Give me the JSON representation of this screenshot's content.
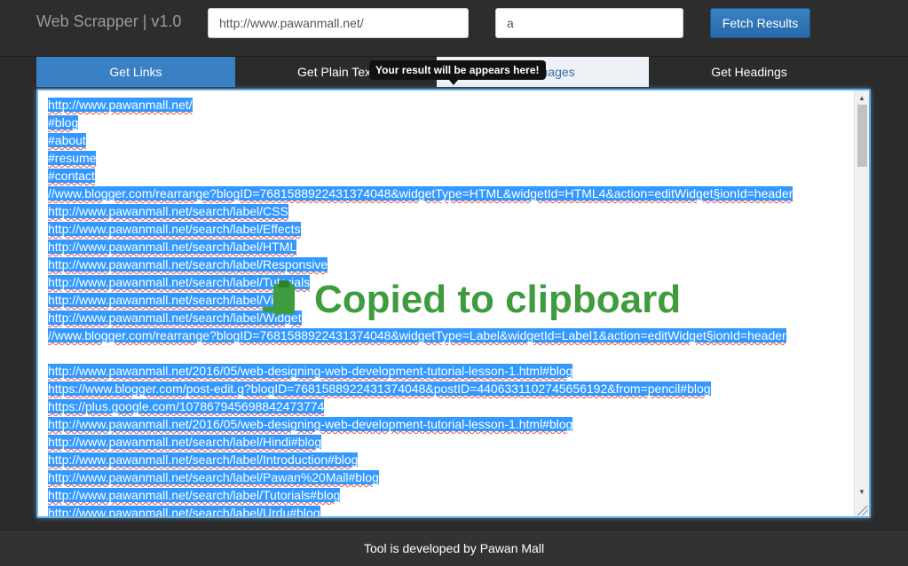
{
  "header": {
    "brand": "Web Scrapper | v1.0",
    "url_value": "http://www.pawanmall.net/",
    "term_value": "a",
    "fetch_label": "Fetch Results"
  },
  "tabs": [
    {
      "label": "Get Links"
    },
    {
      "label": "Get Plain Text"
    },
    {
      "label": "Get Images"
    },
    {
      "label": "Get Headings"
    }
  ],
  "tooltip": "Your result will be appears here!",
  "toast": "Copied to clipboard",
  "result_lines": [
    "http://www.pawanmall.net/",
    "#blog",
    "#about",
    "#resume",
    "#contact",
    "//www.blogger.com/rearrange?blogID=7681588922431374048&widgetType=HTML&widgetId=HTML4&action=editWidget§ionId=header",
    "http://www.pawanmall.net/search/label/CSS",
    "http://www.pawanmall.net/search/label/Effects",
    "http://www.pawanmall.net/search/label/HTML",
    "http://www.pawanmall.net/search/label/Responsive",
    "http://www.pawanmall.net/search/label/Tutorials",
    "http://www.pawanmall.net/search/label/Video",
    "http://www.pawanmall.net/search/label/Widget",
    "//www.blogger.com/rearrange?blogID=7681588922431374048&widgetType=Label&widgetId=Label1&action=editWidget§ionId=header",
    "",
    "http://www.pawanmall.net/2016/05/web-designing-web-development-tutorial-lesson-1.html#blog",
    "https://www.blogger.com/post-edit.g?blogID=7681588922431374048&postID=4406331102745656192&from=pencil#blog",
    "https://plus.google.com/107867945698842473774",
    "http://www.pawanmall.net/2016/05/web-designing-web-development-tutorial-lesson-1.html#blog",
    "http://www.pawanmall.net/search/label/Hindi#blog",
    "http://www.pawanmall.net/search/label/Introduction#blog",
    "http://www.pawanmall.net/search/label/Pawan%20Mall#blog",
    "http://www.pawanmall.net/search/label/Tutorials#blog",
    "http://www.pawanmall.net/search/label/Urdu#blog"
  ],
  "footer": "Tool is developed by Pawan Mall",
  "colors": {
    "accent": "#3a80c4",
    "selection": "#3399ff",
    "toast": "#3e9c3e"
  }
}
